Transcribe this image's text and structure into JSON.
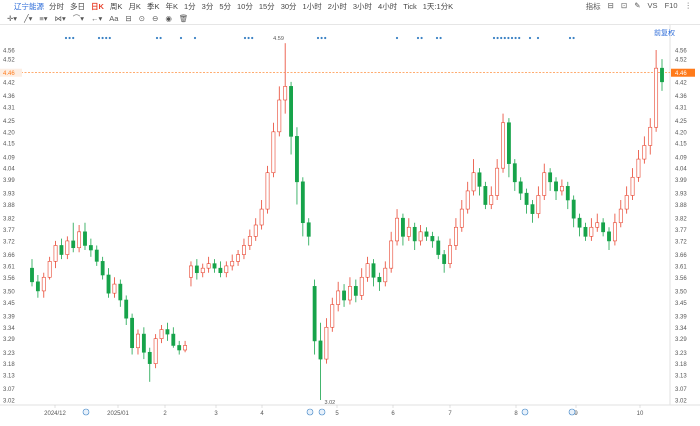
{
  "toolbar": {
    "stock_name": "辽宁能源",
    "intervals": [
      "分时",
      "多日",
      "日K",
      "周K",
      "月K",
      "季K",
      "年K",
      "1分",
      "3分",
      "5分",
      "10分",
      "15分",
      "30分",
      "1小时",
      "2小时",
      "3小时",
      "4小时",
      "Tick",
      "1天:1分K"
    ],
    "active_interval": "日K",
    "right_items": [
      "指标",
      "⊟",
      "⊡",
      "✎",
      "VS",
      "F10",
      "⋮"
    ]
  },
  "toolbar2": {
    "draw_label": "Aa"
  },
  "price_axis": {
    "ticks": [
      "4.56",
      "4.52",
      "4.46",
      "4.42",
      "4.36",
      "4.31",
      "4.25",
      "4.20",
      "4.15",
      "4.09",
      "4.04",
      "3.99",
      "3.93",
      "3.88",
      "3.82",
      "3.77",
      "3.72",
      "3.66",
      "3.61",
      "3.56",
      "3.50",
      "3.45",
      "3.39",
      "3.34",
      "3.29",
      "3.23",
      "3.18",
      "3.13",
      "3.07",
      "3.02"
    ],
    "current_price": "4.46",
    "fq_label": "前复权"
  },
  "colors": {
    "up": "#e8432e",
    "down": "#16a34a",
    "current_line": "#ff7a1a",
    "marker": "#3b82c4"
  },
  "annotations": {
    "high": "4.59",
    "low": "3.02"
  },
  "chart_data": {
    "type": "candlestick",
    "x_labels": [
      "2024/12",
      "2025/01",
      "2",
      "3",
      "4",
      "5",
      "6",
      "7",
      "8",
      "9",
      "10"
    ],
    "y_range": [
      3.02,
      4.56
    ],
    "high_label": "4.59",
    "low_label": "3.02",
    "current_price": 4.46,
    "candles": [
      [
        3.6,
        3.54,
        3.64,
        3.52
      ],
      [
        3.54,
        3.5,
        3.57,
        3.47
      ],
      [
        3.5,
        3.56,
        3.58,
        3.47
      ],
      [
        3.56,
        3.63,
        3.65,
        3.55
      ],
      [
        3.63,
        3.7,
        3.72,
        3.6
      ],
      [
        3.7,
        3.66,
        3.73,
        3.64
      ],
      [
        3.66,
        3.72,
        3.74,
        3.64
      ],
      [
        3.72,
        3.69,
        3.8,
        3.67
      ],
      [
        3.69,
        3.76,
        3.79,
        3.67
      ],
      [
        3.76,
        3.7,
        3.8,
        3.68
      ],
      [
        3.7,
        3.68,
        3.73,
        3.65
      ],
      [
        3.68,
        3.63,
        3.7,
        3.61
      ],
      [
        3.63,
        3.57,
        3.65,
        3.55
      ],
      [
        3.57,
        3.49,
        3.6,
        3.47
      ],
      [
        3.49,
        3.53,
        3.56,
        3.47
      ],
      [
        3.53,
        3.46,
        3.55,
        3.43
      ],
      [
        3.46,
        3.38,
        3.48,
        3.35
      ],
      [
        3.38,
        3.25,
        3.4,
        3.22
      ],
      [
        3.25,
        3.31,
        3.33,
        3.22
      ],
      [
        3.31,
        3.23,
        3.34,
        3.2
      ],
      [
        3.23,
        3.18,
        3.25,
        3.1
      ],
      [
        3.18,
        3.29,
        3.31,
        3.16
      ],
      [
        3.29,
        3.33,
        3.35,
        3.27
      ],
      [
        3.33,
        3.31,
        3.36,
        3.28
      ],
      [
        3.31,
        3.26,
        3.34,
        3.25
      ],
      [
        3.26,
        3.24,
        3.28,
        3.22
      ],
      [
        3.24,
        3.26,
        3.28,
        3.23
      ],
      [
        3.56,
        3.61,
        3.63,
        3.52
      ],
      [
        3.61,
        3.58,
        3.64,
        3.55
      ],
      [
        3.58,
        3.6,
        3.62,
        3.56
      ],
      [
        3.6,
        3.62,
        3.65,
        3.58
      ],
      [
        3.62,
        3.6,
        3.64,
        3.58
      ],
      [
        3.6,
        3.58,
        3.63,
        3.56
      ],
      [
        3.58,
        3.61,
        3.63,
        3.56
      ],
      [
        3.61,
        3.63,
        3.66,
        3.59
      ],
      [
        3.63,
        3.66,
        3.68,
        3.61
      ],
      [
        3.66,
        3.7,
        3.73,
        3.64
      ],
      [
        3.7,
        3.74,
        3.77,
        3.68
      ],
      [
        3.74,
        3.79,
        3.82,
        3.72
      ],
      [
        3.79,
        3.86,
        3.9,
        3.77
      ],
      [
        3.86,
        4.02,
        4.05,
        3.84
      ],
      [
        4.02,
        4.2,
        4.24,
        4.0
      ],
      [
        4.2,
        4.34,
        4.4,
        4.18
      ],
      [
        4.34,
        4.4,
        4.59,
        4.28
      ],
      [
        4.4,
        4.18,
        4.42,
        4.1
      ],
      [
        4.18,
        3.98,
        4.22,
        3.88
      ],
      [
        3.98,
        3.8,
        4.0,
        3.74
      ],
      [
        3.8,
        3.74,
        3.82,
        3.7
      ],
      [
        3.52,
        3.28,
        3.55,
        3.22
      ],
      [
        3.28,
        3.2,
        3.36,
        3.02
      ],
      [
        3.2,
        3.34,
        3.38,
        3.18
      ],
      [
        3.34,
        3.44,
        3.47,
        3.32
      ],
      [
        3.44,
        3.5,
        3.54,
        3.41
      ],
      [
        3.5,
        3.46,
        3.53,
        3.43
      ],
      [
        3.46,
        3.52,
        3.56,
        3.44
      ],
      [
        3.52,
        3.48,
        3.55,
        3.45
      ],
      [
        3.48,
        3.56,
        3.6,
        3.46
      ],
      [
        3.56,
        3.62,
        3.65,
        3.54
      ],
      [
        3.62,
        3.56,
        3.64,
        3.52
      ],
      [
        3.56,
        3.54,
        3.58,
        3.5
      ],
      [
        3.54,
        3.6,
        3.63,
        3.52
      ],
      [
        3.6,
        3.72,
        3.76,
        3.58
      ],
      [
        3.72,
        3.82,
        3.86,
        3.7
      ],
      [
        3.82,
        3.74,
        3.84,
        3.7
      ],
      [
        3.74,
        3.78,
        3.82,
        3.72
      ],
      [
        3.78,
        3.72,
        3.8,
        3.68
      ],
      [
        3.72,
        3.76,
        3.79,
        3.7
      ],
      [
        3.76,
        3.74,
        3.78,
        3.72
      ],
      [
        3.74,
        3.72,
        3.76,
        3.69
      ],
      [
        3.72,
        3.66,
        3.74,
        3.64
      ],
      [
        3.66,
        3.62,
        3.68,
        3.58
      ],
      [
        3.62,
        3.7,
        3.73,
        3.6
      ],
      [
        3.7,
        3.78,
        3.82,
        3.68
      ],
      [
        3.78,
        3.86,
        3.9,
        3.76
      ],
      [
        3.86,
        3.94,
        3.98,
        3.84
      ],
      [
        3.94,
        4.02,
        4.08,
        3.92
      ],
      [
        4.02,
        3.96,
        4.04,
        3.92
      ],
      [
        3.96,
        3.88,
        3.98,
        3.86
      ],
      [
        3.88,
        3.92,
        3.96,
        3.86
      ],
      [
        3.92,
        4.04,
        4.08,
        3.9
      ],
      [
        4.04,
        4.24,
        4.28,
        4.02
      ],
      [
        4.24,
        4.06,
        4.26,
        4.0
      ],
      [
        4.06,
        3.98,
        4.08,
        3.94
      ],
      [
        3.98,
        3.93,
        4.0,
        3.9
      ],
      [
        3.93,
        3.88,
        3.95,
        3.84
      ],
      [
        3.88,
        3.84,
        3.9,
        3.8
      ],
      [
        3.84,
        3.92,
        3.96,
        3.82
      ],
      [
        3.92,
        4.02,
        4.06,
        3.9
      ],
      [
        4.02,
        3.98,
        4.04,
        3.94
      ],
      [
        3.98,
        3.94,
        4.0,
        3.9
      ],
      [
        3.94,
        3.96,
        3.99,
        3.92
      ],
      [
        3.96,
        3.9,
        3.98,
        3.86
      ],
      [
        3.9,
        3.82,
        3.92,
        3.78
      ],
      [
        3.82,
        3.78,
        3.84,
        3.74
      ],
      [
        3.78,
        3.74,
        3.8,
        3.72
      ],
      [
        3.74,
        3.78,
        3.82,
        3.72
      ],
      [
        3.78,
        3.8,
        3.84,
        3.76
      ],
      [
        3.8,
        3.76,
        3.82,
        3.74
      ],
      [
        3.76,
        3.72,
        3.78,
        3.68
      ],
      [
        3.72,
        3.8,
        3.84,
        3.7
      ],
      [
        3.8,
        3.86,
        3.9,
        3.78
      ],
      [
        3.86,
        3.92,
        3.96,
        3.84
      ],
      [
        3.92,
        4.0,
        4.04,
        3.9
      ],
      [
        4.0,
        4.08,
        4.12,
        3.98
      ],
      [
        4.08,
        4.14,
        4.18,
        4.06
      ],
      [
        4.14,
        4.22,
        4.26,
        4.1
      ],
      [
        4.22,
        4.48,
        4.56,
        4.2
      ],
      [
        4.48,
        4.42,
        4.52,
        4.38
      ]
    ]
  }
}
